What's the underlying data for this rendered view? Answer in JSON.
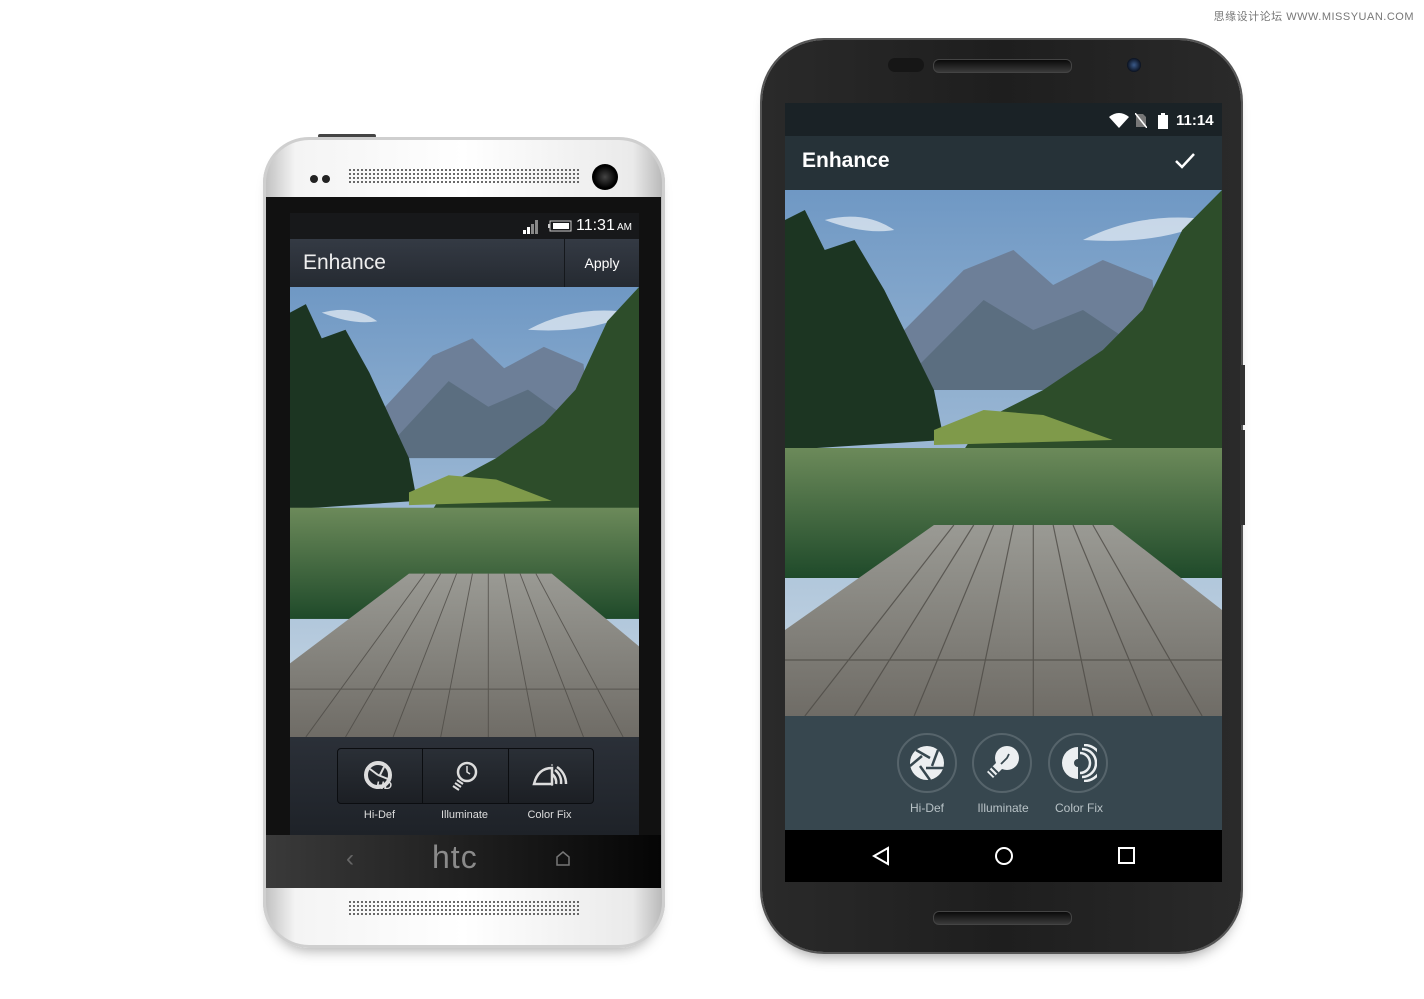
{
  "watermark": "思缘设计论坛 WWW.MISSYUAN.COM",
  "htc": {
    "brand_logo": "htc",
    "status": {
      "time": "11:31",
      "ampm": "AM",
      "icons": [
        "signal-icon",
        "battery-icon"
      ]
    },
    "app_bar": {
      "title": "Enhance",
      "apply_label": "Apply"
    },
    "tools": [
      {
        "label": "Hi-Def",
        "icon": "hd-aperture-icon"
      },
      {
        "label": "Illuminate",
        "icon": "lightbulb-icon"
      },
      {
        "label": "Color Fix",
        "icon": "color-fix-icon"
      }
    ],
    "nav": [
      "back-icon",
      "home-icon"
    ]
  },
  "nexus": {
    "status": {
      "time": "11:14",
      "icons": [
        "wifi-icon",
        "no-sim-icon",
        "battery-icon"
      ]
    },
    "app_bar": {
      "title": "Enhance",
      "confirm_icon": "check-icon"
    },
    "tools": [
      {
        "label": "Hi-Def",
        "icon": "aperture-icon"
      },
      {
        "label": "Illuminate",
        "icon": "lightbulb-icon"
      },
      {
        "label": "Color Fix",
        "icon": "color-fix-icon"
      }
    ],
    "nav": [
      "back-icon",
      "home-icon",
      "recents-icon"
    ],
    "colors": {
      "app_bar": "#263238",
      "panel": "#37474f"
    }
  }
}
